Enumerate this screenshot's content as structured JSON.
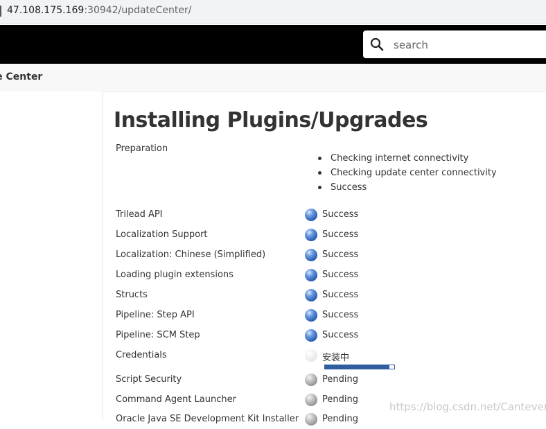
{
  "browser": {
    "url_host": "47.108.175.169",
    "url_path": ":30942/updateCenter/"
  },
  "header": {
    "search_placeholder": "search",
    "search_icon": "search-icon"
  },
  "breadcrumb": {
    "label": "ate Center"
  },
  "main": {
    "title": "Installing Plugins/Upgrades",
    "preparation": {
      "label": "Preparation",
      "checks": [
        "Checking internet connectivity",
        "Checking update center connectivity",
        "Success"
      ]
    },
    "plugins": [
      {
        "name": "Trilead API",
        "status": "Success",
        "icon": "blue-ball-icon"
      },
      {
        "name": "Localization Support",
        "status": "Success",
        "icon": "blue-ball-icon"
      },
      {
        "name": "Localization: Chinese (Simplified)",
        "status": "Success",
        "icon": "blue-ball-icon"
      },
      {
        "name": "Loading plugin extensions",
        "status": "Success",
        "icon": "blue-ball-icon"
      },
      {
        "name": "Structs",
        "status": "Success",
        "icon": "blue-ball-icon"
      },
      {
        "name": "Pipeline: Step API",
        "status": "Success",
        "icon": "blue-ball-icon"
      },
      {
        "name": "Pipeline: SCM Step",
        "status": "Success",
        "icon": "blue-ball-icon"
      },
      {
        "name": "Credentials",
        "status": "安装中",
        "icon": "faint-ball-icon",
        "progress": 0.93
      },
      {
        "name": "Script Security",
        "status": "Pending",
        "icon": "grey-ball-icon"
      },
      {
        "name": "Command Agent Launcher",
        "status": "Pending",
        "icon": "grey-ball-icon"
      },
      {
        "name": "Oracle Java SE Development Kit Installer",
        "status": "Pending",
        "icon": "grey-ball-icon"
      }
    ]
  },
  "watermark": "https://blog.csdn.net/Canteven!",
  "colors": {
    "header_bg": "#000000",
    "success_ball": "#2c5fb5",
    "pending_ball": "#8c8c8c"
  }
}
